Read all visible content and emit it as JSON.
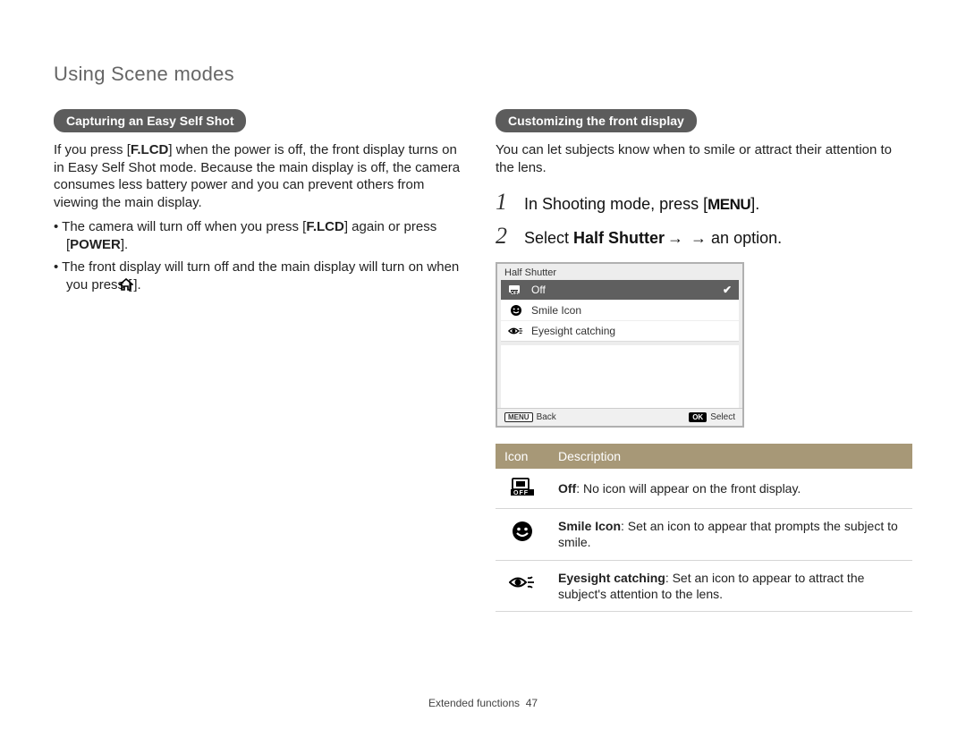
{
  "pageTitle": "Using Scene modes",
  "left": {
    "heading": "Capturing an Easy Self Shot",
    "para_a": "If you press [",
    "para_b": "F.LCD",
    "para_c": "] when the power is off, the front display turns on in Easy Self Shot mode. Because the main display is off, the camera consumes less battery power and you can prevent others from viewing the main display.",
    "b1_a": "The camera will turn off when you press [",
    "b1_b": "F.LCD",
    "b1_c": "] again or press [",
    "b1_d": "POWER",
    "b1_e": "].",
    "b2_a": "The front display will turn off and the main display will turn on when you press [",
    "b2_b": "]."
  },
  "right": {
    "heading": "Customizing the front display",
    "intro": "You can let subjects know when to smile or attract their attention to the lens.",
    "step1_a": "In Shooting mode, press [",
    "step1_b": "].",
    "step2_a": "Select ",
    "step2_b": "Half Shutter",
    "step2_c": " → an option."
  },
  "lcd": {
    "title": "Half Shutter",
    "rows": [
      {
        "label": "Off",
        "selected": true
      },
      {
        "label": "Smile Icon",
        "selected": false
      },
      {
        "label": "Eyesight catching",
        "selected": false
      }
    ],
    "back": "Back",
    "select": "Select",
    "menuTag": "MENU",
    "okTag": "OK"
  },
  "table": {
    "h1": "Icon",
    "h2": "Description",
    "rows": [
      {
        "label": "Off",
        "text": ": No icon will appear on the front display."
      },
      {
        "label": "Smile Icon",
        "text": ": Set an icon to appear that prompts the subject to smile."
      },
      {
        "label": "Eyesight catching",
        "text": ": Set an icon to appear to attract the subject's attention to the lens."
      }
    ]
  },
  "footer": {
    "section": "Extended functions",
    "page": "47"
  },
  "menuWord": "MENU"
}
